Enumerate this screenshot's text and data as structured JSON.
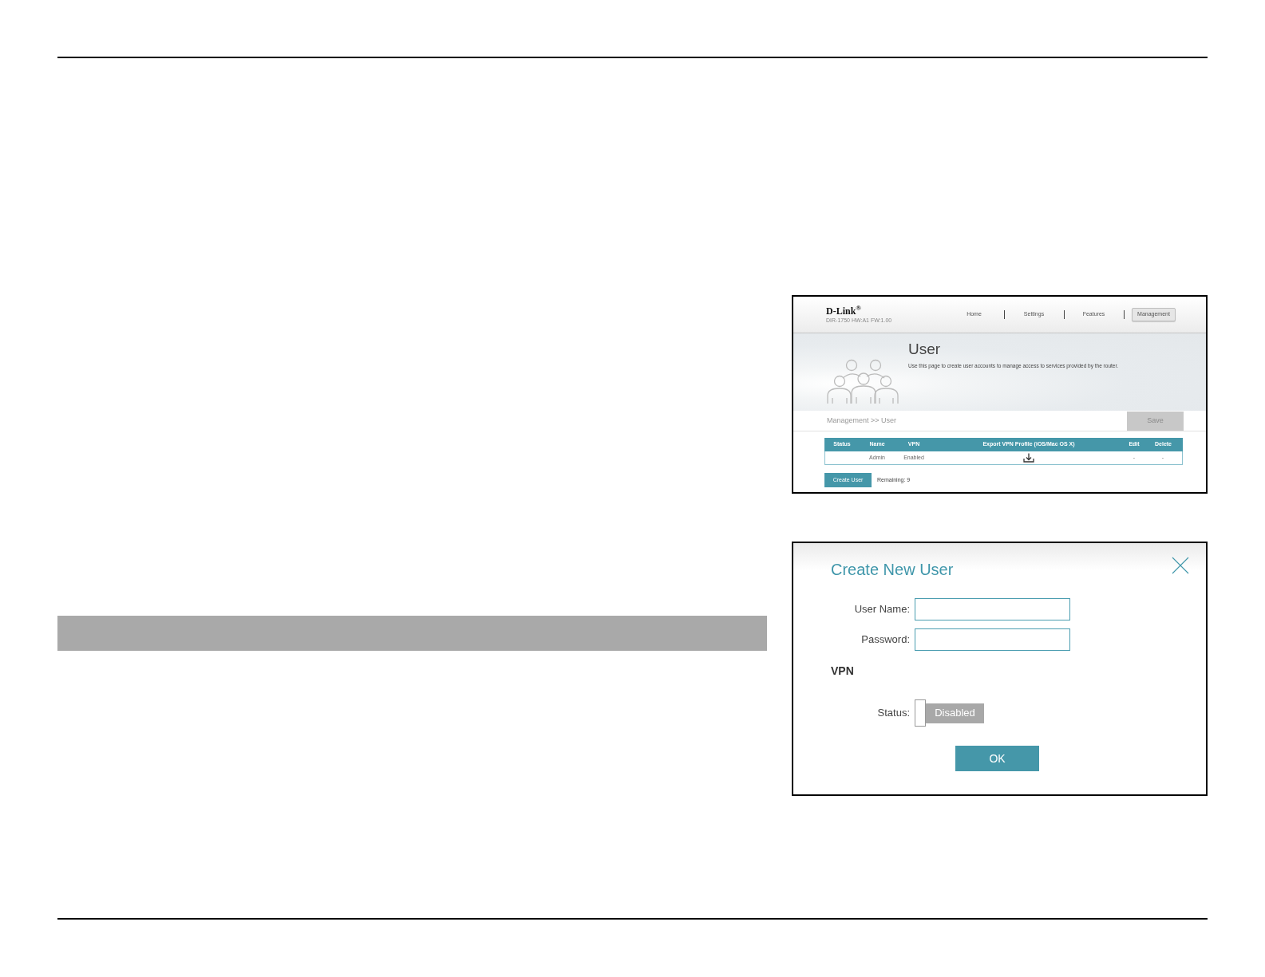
{
  "screenshot": {
    "logo": "D-Link$^{®}$",
    "model": "DIR-1750 HW:A1 FW:1.00",
    "nav": [
      {
        "label": "Home",
        "selected": false
      },
      {
        "label": "Settings",
        "selected": false
      },
      {
        "label": "Features",
        "selected": false
      },
      {
        "label": "Management",
        "selected": true
      }
    ],
    "title": "User",
    "description": "Use this page to create user accounts to manage access to services provided by the router.",
    "breadcrumb": "Management >> User",
    "save_button": {
      "label": "Save",
      "disabled": true
    },
    "table": {
      "columns": [
        "Status",
        "Name",
        "VPN",
        "Export VPN Profile (iOS/Mac OS X)",
        "Edit",
        "Delete"
      ],
      "rows": [
        {
          "name": "Admin",
          "vpn": "Enabled",
          "edit": "-",
          "delete": "-"
        }
      ]
    },
    "create_button": "Create User",
    "remaining": "Remaining: 9"
  },
  "dialog": {
    "title": "Create New User",
    "fields": [
      {
        "label": "User Name:"
      },
      {
        "label": "Password:"
      }
    ],
    "section": "VPN",
    "status": {
      "label": "Status:",
      "on": false,
      "state_text": "Disabled"
    },
    "ok_button": "OK"
  }
}
